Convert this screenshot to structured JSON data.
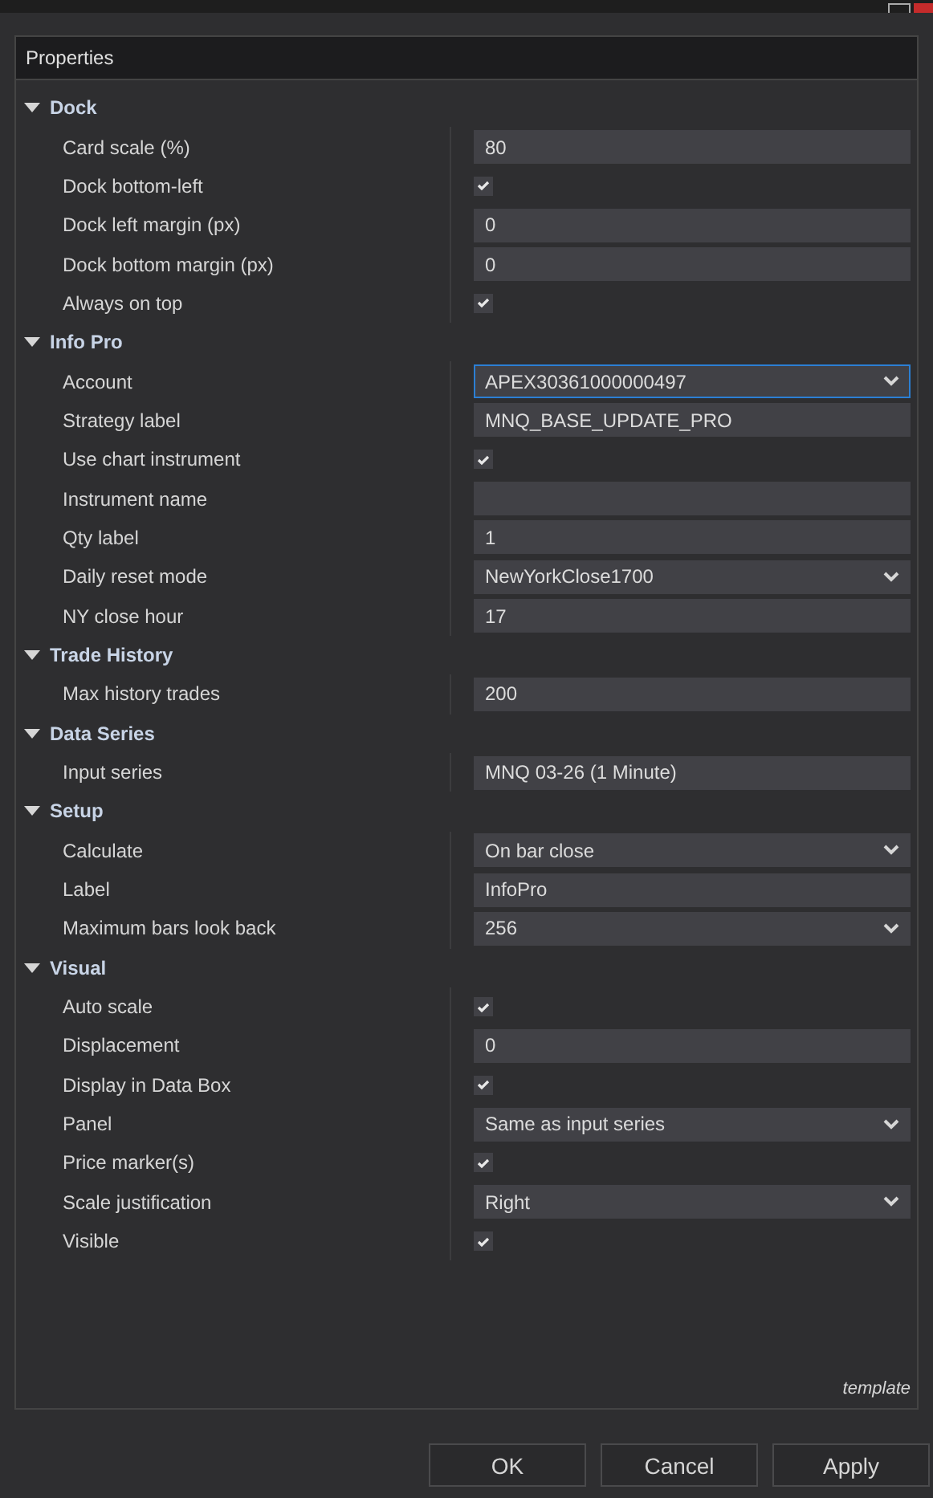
{
  "panel": {
    "title": "Properties",
    "footer": "template"
  },
  "categories": [
    {
      "name": "Dock",
      "expanded": true,
      "properties": [
        {
          "label": "Card scale (%)",
          "kind": "text",
          "value": "80"
        },
        {
          "label": "Dock bottom-left",
          "kind": "check",
          "checked": true
        },
        {
          "label": "Dock left margin (px)",
          "kind": "text",
          "value": "0"
        },
        {
          "label": "Dock bottom margin (px)",
          "kind": "text",
          "value": "0"
        },
        {
          "label": "Always on top",
          "kind": "check",
          "checked": true
        }
      ]
    },
    {
      "name": "Info Pro",
      "expanded": true,
      "properties": [
        {
          "label": "Account",
          "kind": "select",
          "value": "APEX30361000000497",
          "focused": true
        },
        {
          "label": "Strategy label",
          "kind": "text",
          "value": "MNQ_BASE_UPDATE_PRO"
        },
        {
          "label": "Use chart instrument",
          "kind": "check",
          "checked": true
        },
        {
          "label": "Instrument name",
          "kind": "text"
        },
        {
          "label": "Qty label",
          "kind": "text",
          "value": "1"
        },
        {
          "label": "Daily reset mode",
          "kind": "select",
          "value": "NewYorkClose1700",
          "focused": false
        },
        {
          "label": "NY close hour",
          "kind": "text",
          "value": "17"
        }
      ]
    },
    {
      "name": "Trade History",
      "expanded": true,
      "properties": [
        {
          "label": "Max history trades",
          "kind": "text",
          "value": "200"
        }
      ]
    },
    {
      "name": "Data Series",
      "expanded": true,
      "properties": [
        {
          "label": "Input series",
          "kind": "text",
          "value": "MNQ 03-26 (1 Minute)"
        }
      ]
    },
    {
      "name": "Setup",
      "expanded": true,
      "properties": [
        {
          "label": "Calculate",
          "kind": "select",
          "value": "On bar close",
          "focused": false
        },
        {
          "label": "Label",
          "kind": "text",
          "value": "InfoPro"
        },
        {
          "label": "Maximum bars look back",
          "kind": "select",
          "value": "256",
          "focused": false
        }
      ]
    },
    {
      "name": "Visual",
      "expanded": true,
      "properties": [
        {
          "label": "Auto scale",
          "kind": "check",
          "checked": true
        },
        {
          "label": "Displacement",
          "kind": "text",
          "value": "0"
        },
        {
          "label": "Display in Data Box",
          "kind": "check",
          "checked": true
        },
        {
          "label": "Panel",
          "kind": "select",
          "value": "Same as input series",
          "focused": false
        },
        {
          "label": "Price marker(s)",
          "kind": "check",
          "checked": true
        },
        {
          "label": "Scale justification",
          "kind": "select",
          "value": "Right",
          "focused": false
        },
        {
          "label": "Visible",
          "kind": "check",
          "checked": true
        }
      ]
    }
  ],
  "buttons": [
    "OK",
    "Cancel",
    "Apply"
  ]
}
